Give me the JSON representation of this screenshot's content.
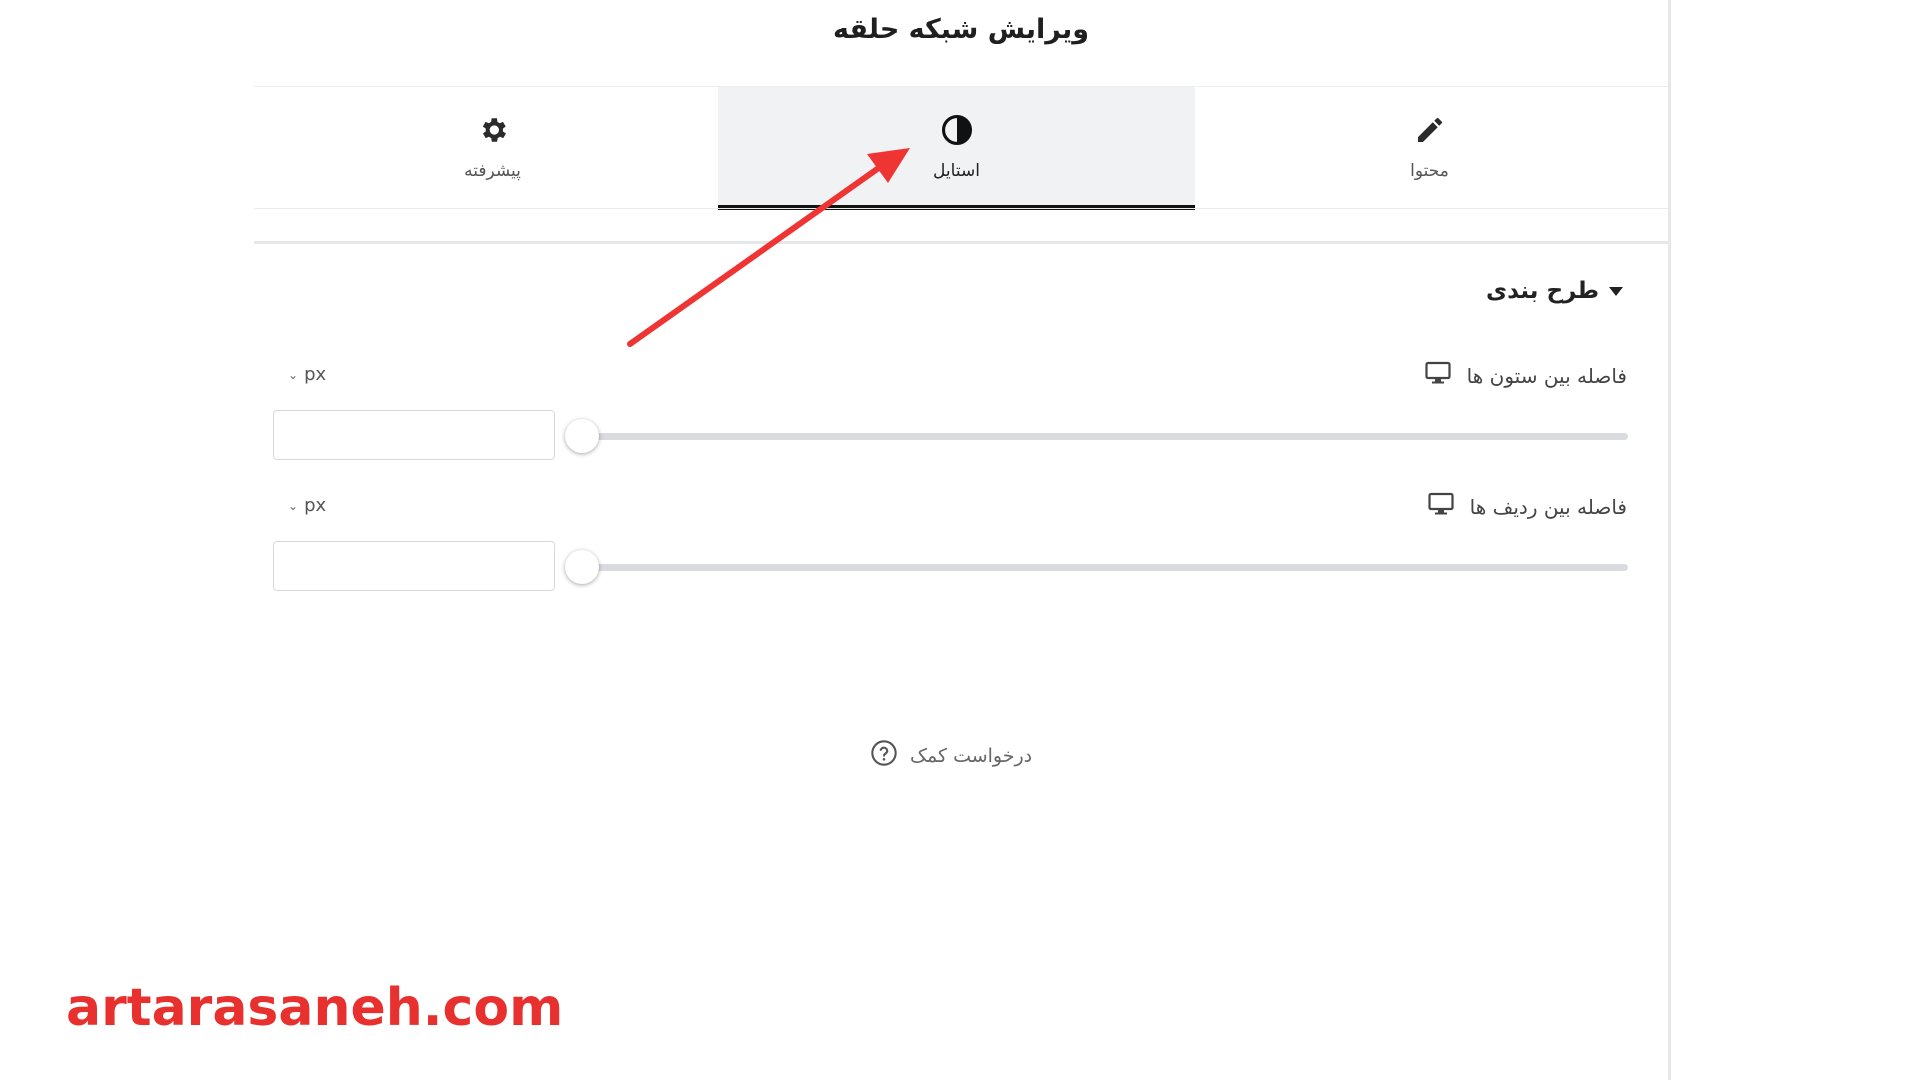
{
  "panel": {
    "title": "ویرایش شبکه حلقه"
  },
  "tabs": [
    {
      "label": "پیشرفته",
      "icon": "gear-icon"
    },
    {
      "label": "استایل",
      "icon": "contrast-icon",
      "active": true
    },
    {
      "label": "محتوا",
      "icon": "pencil-icon"
    }
  ],
  "section": {
    "title": "طرح بندی"
  },
  "controls": {
    "column_gap": {
      "label": "فاصله بین ستون ها",
      "unit": "px",
      "value": "",
      "device_icon": "desktop-icon"
    },
    "row_gap": {
      "label": "فاصله بین ردیف ها",
      "unit": "px",
      "value": "",
      "device_icon": "desktop-icon"
    }
  },
  "help": {
    "label": "درخواست کمک",
    "icon": "question-circle-icon"
  },
  "watermark": {
    "text": "artarasaneh.com",
    "color": "#e8302e"
  },
  "annotation": {
    "arrow_color": "#e8302e"
  }
}
